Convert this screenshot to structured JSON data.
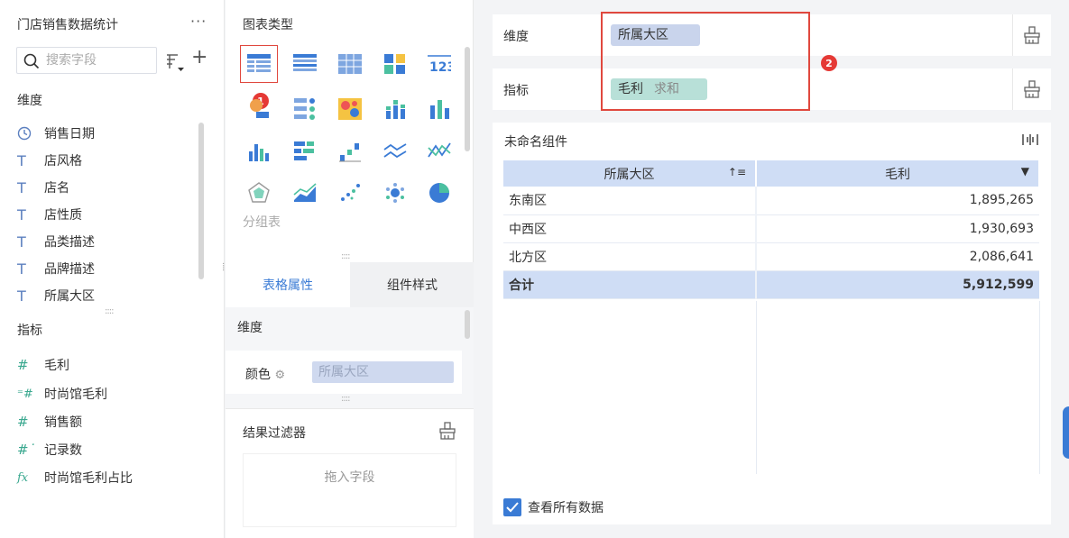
{
  "left": {
    "title": "门店销售数据统计",
    "more": "···",
    "search_placeholder": "搜索字段",
    "dimension_label": "维度",
    "dimensions": [
      {
        "icon": "clock-icon",
        "label": "销售日期"
      },
      {
        "icon": "text-icon",
        "label": "店风格"
      },
      {
        "icon": "text-icon",
        "label": "店名"
      },
      {
        "icon": "text-icon",
        "label": "店性质"
      },
      {
        "icon": "text-icon",
        "label": "品类描述"
      },
      {
        "icon": "text-icon",
        "label": "品牌描述"
      },
      {
        "icon": "text-icon",
        "label": "所属大区"
      }
    ],
    "measure_label": "指标",
    "measures": [
      {
        "icon": "hash-icon",
        "label": "毛利"
      },
      {
        "icon": "calc-hash-icon",
        "label": "时尚馆毛利"
      },
      {
        "icon": "hash-icon",
        "label": "销售额"
      },
      {
        "icon": "count-hash-icon",
        "label": "记录数"
      },
      {
        "icon": "formula-icon",
        "label": "时尚馆毛利占比"
      }
    ]
  },
  "middle": {
    "chart_type_label": "图表类型",
    "selected_chart_label": "分组表",
    "badge1": "1",
    "tabs": [
      "表格属性",
      "组件样式"
    ],
    "dimension_label": "维度",
    "color_label": "颜色",
    "color_field": "所属大区",
    "filter_title": "结果过滤器",
    "drop_hint": "拖入字段"
  },
  "right": {
    "dimension_row_label": "维度",
    "dimension_pill": "所属大区",
    "measure_row_label": "指标",
    "measure_pill": "毛利",
    "measure_agg": "求和",
    "badge2": "2",
    "widget_title": "未命名组件",
    "table": {
      "headers": [
        "所属大区",
        "毛利"
      ],
      "rows": [
        [
          "东南区",
          "1,895,265"
        ],
        [
          "中西区",
          "1,930,693"
        ],
        [
          "北方区",
          "2,086,641"
        ]
      ],
      "total": [
        "合计",
        "5,912,599"
      ]
    },
    "view_all_label": "查看所有数据"
  },
  "colors": {
    "accent": "#3a7bd5",
    "highlight": "#e0483e",
    "header_bg": "#cfddf5"
  }
}
